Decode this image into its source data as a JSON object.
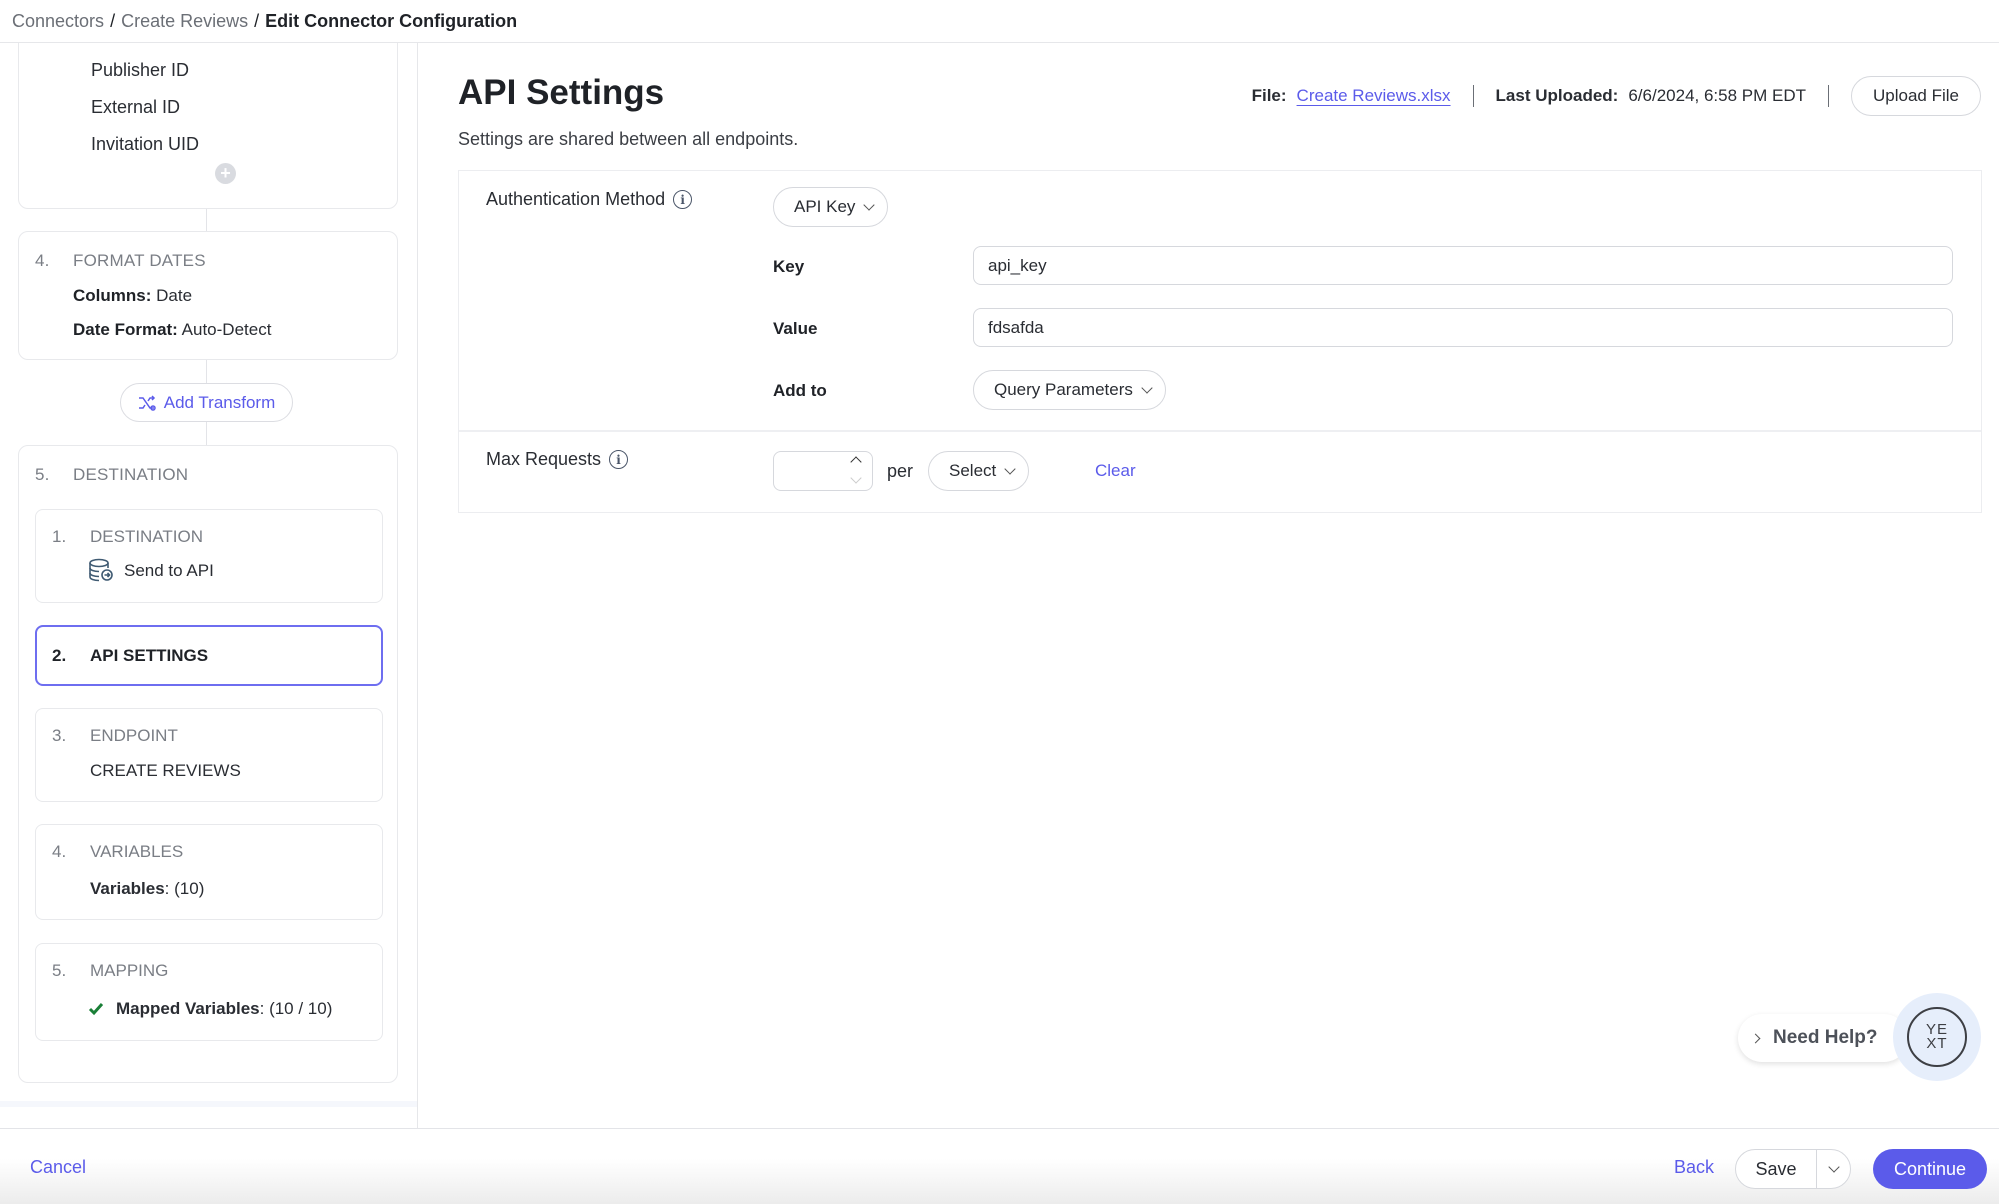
{
  "breadcrumb": {
    "items": [
      "Connectors",
      "Create Reviews"
    ],
    "separator": "/",
    "current": "Edit Connector Configuration"
  },
  "sidebar": {
    "fields": [
      "Publisher ID",
      "External ID",
      "Invitation UID"
    ],
    "add_field_icon": "plus-circle-icon",
    "format_dates": {
      "number": "4.",
      "title": "FORMAT DATES",
      "columns_label": "Columns:",
      "columns_value": "Date",
      "date_format_label": "Date Format:",
      "date_format_value": "Auto-Detect"
    },
    "add_transform_label": "Add Transform",
    "destination": {
      "number": "5.",
      "title": "DESTINATION",
      "substeps": [
        {
          "number": "1.",
          "title": "DESTINATION",
          "detail": "Send to API",
          "icon": "database-send-icon"
        },
        {
          "number": "2.",
          "title": "API SETTINGS",
          "active": true
        },
        {
          "number": "3.",
          "title": "ENDPOINT",
          "detail": "CREATE REVIEWS"
        },
        {
          "number": "4.",
          "title": "VARIABLES",
          "detail_label": "Variables",
          "detail_value": ": (10)"
        },
        {
          "number": "5.",
          "title": "MAPPING",
          "detail_label": "Mapped Variables",
          "detail_value": ": (10 / 10)",
          "icon": "check-icon"
        }
      ]
    }
  },
  "main": {
    "title": "API Settings",
    "subtitle": "Settings are shared between all endpoints.",
    "file_label": "File:",
    "file_name": "Create Reviews.xlsx",
    "last_uploaded_label": "Last Uploaded:",
    "last_uploaded_value": "6/6/2024, 6:58 PM EDT",
    "upload_button": "Upload File",
    "auth": {
      "label": "Authentication Method",
      "method": "API Key",
      "key_label": "Key",
      "key_value": "api_key",
      "value_label": "Value",
      "value_value": "fdsafda",
      "add_to_label": "Add to",
      "add_to_value": "Query Parameters"
    },
    "max_requests": {
      "label": "Max Requests",
      "value": "",
      "per_label": "per",
      "period_value": "Select",
      "clear_label": "Clear"
    }
  },
  "help": {
    "label": "Need Help?",
    "logo_top": "YE",
    "logo_bottom": "XT"
  },
  "footer": {
    "cancel": "Cancel",
    "back": "Back",
    "save": "Save",
    "continue": "Continue"
  },
  "colors": {
    "accent": "#5b5bea",
    "success": "#1a7f37"
  }
}
